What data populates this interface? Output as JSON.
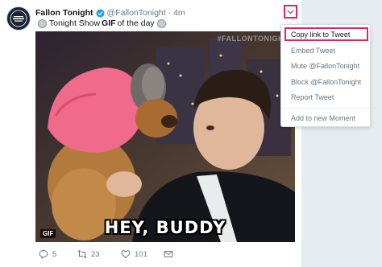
{
  "tweet": {
    "display_name": "Fallon Tonight",
    "handle": "@FallonTonight",
    "separator": "·",
    "time": "4m",
    "text_before": "Tonight Show",
    "text_bold": "GIF",
    "text_after": "of the day",
    "avatar_label": "THE TONIGHT SHOW STARRING JIMMY FALLON"
  },
  "media": {
    "watermark": "#FALLONTONIGHT",
    "caption": "HEY, BUDDY",
    "badge": "GIF"
  },
  "actions": {
    "reply_count": "5",
    "retweet_count": "23",
    "like_count": "101"
  },
  "menu": {
    "items": [
      "Copy link to Tweet",
      "Embed Tweet",
      "Mute @FallonTonight",
      "Block @FallonTonight",
      "Report Tweet",
      "Add to new Moment"
    ]
  },
  "colors": {
    "highlight": "#e0245e",
    "verified": "#1da1f2",
    "muted_text": "#657786",
    "gutter": "#e6ecf0"
  },
  "icons": [
    "verified-badge-icon",
    "chevron-down-icon",
    "reply-icon",
    "retweet-icon",
    "heart-icon",
    "direct-message-icon",
    "emoji-icon"
  ]
}
